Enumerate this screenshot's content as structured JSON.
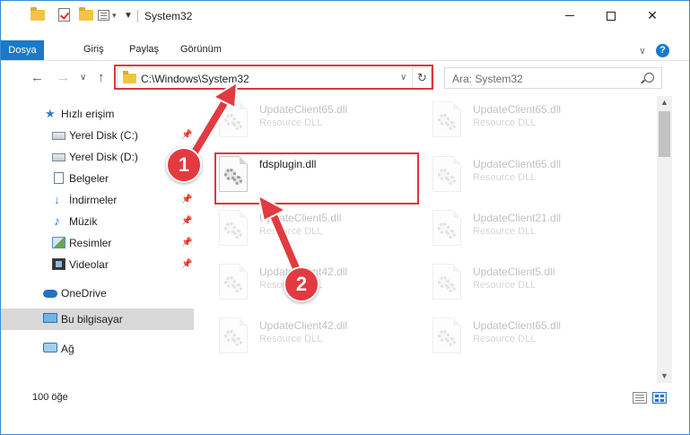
{
  "window": {
    "title": "System32"
  },
  "ribbon": {
    "tabs": [
      {
        "label": "Dosya",
        "active": true
      },
      {
        "label": "Giriş"
      },
      {
        "label": "Paylaş"
      },
      {
        "label": "Görünüm"
      }
    ],
    "help_label": "?"
  },
  "navigation": {
    "address": "C:\\Windows\\System32",
    "search_placeholder": "Ara: System32"
  },
  "sidebar": {
    "items": [
      {
        "label": "Hızlı erişim",
        "icon": "star-icon",
        "pinned": false
      },
      {
        "label": "Yerel Disk (C:)",
        "icon": "drive-icon",
        "pinned": true
      },
      {
        "label": "Yerel Disk (D:)",
        "icon": "drive-icon",
        "pinned": false
      },
      {
        "label": "Belgeler",
        "icon": "document-icon",
        "pinned": true
      },
      {
        "label": "İndirmeler",
        "icon": "download-icon",
        "pinned": true
      },
      {
        "label": "Müzik",
        "icon": "music-icon",
        "pinned": true
      },
      {
        "label": "Resimler",
        "icon": "picture-icon",
        "pinned": true
      },
      {
        "label": "Videolar",
        "icon": "video-icon",
        "pinned": true
      },
      {
        "label": "OneDrive",
        "icon": "cloud-icon",
        "pinned": false
      },
      {
        "label": "Bu bilgisayar",
        "icon": "computer-icon",
        "selected": true
      },
      {
        "label": "Ağ",
        "icon": "network-icon",
        "pinned": false
      }
    ]
  },
  "files": [
    {
      "name": "UpdateClient65.dll",
      "type": "Resource DLL"
    },
    {
      "name": "UpdateClient65.dll",
      "type": "Resource DLL"
    },
    {
      "name": "fdsplugin.dll",
      "type": ""
    },
    {
      "name": "UpdateClient65.dll",
      "type": "Resource DLL"
    },
    {
      "name": "UpdateClient5.dll",
      "type": "Resource DLL"
    },
    {
      "name": "UpdateClient21.dll",
      "type": "Resource DLL"
    },
    {
      "name": "UpdateClient42.dll",
      "type": "Resource DLL"
    },
    {
      "name": "UpdateClient5.dll",
      "type": "Resource DLL"
    },
    {
      "name": "UpdateClient42.dll",
      "type": "Resource DLL"
    },
    {
      "name": "UpdateClient65.dll",
      "type": "Resource DLL"
    }
  ],
  "status": {
    "item_count": "100 öğe"
  },
  "annotations": {
    "step1": "1",
    "step2": "2",
    "highlight_color": "#e0343d"
  },
  "colors": {
    "accent": "#1979ca",
    "annotation_red": "#e23a40"
  }
}
